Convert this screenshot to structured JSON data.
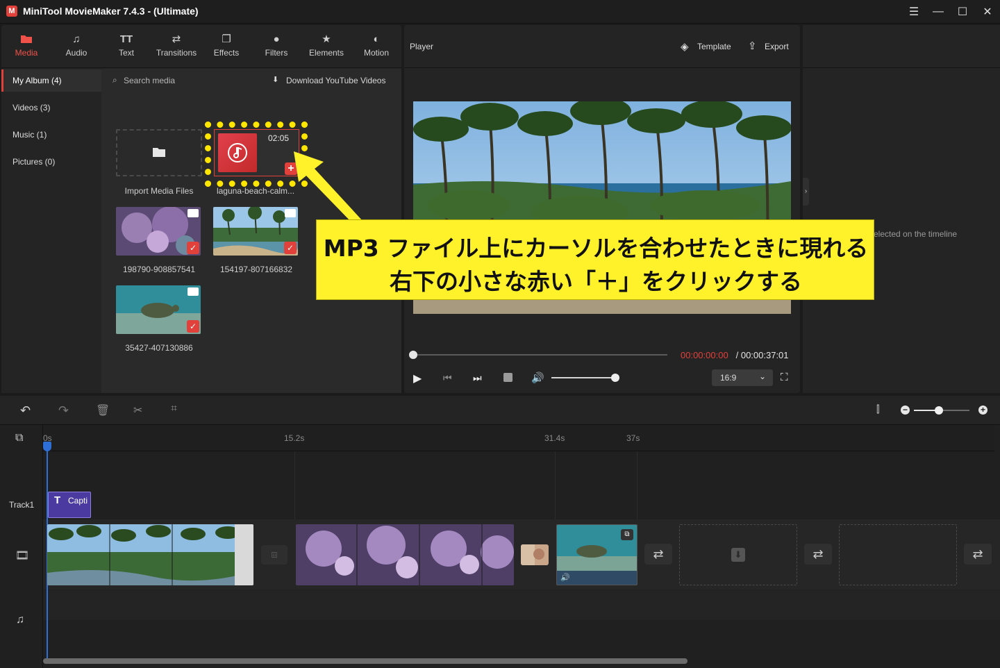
{
  "window": {
    "title": "MiniTool MovieMaker 7.4.3 - (Ultimate)"
  },
  "toolbar_tabs": [
    {
      "label": "Media",
      "icon": "folder-icon"
    },
    {
      "label": "Audio",
      "icon": "music-note-icon"
    },
    {
      "label": "Text",
      "icon": "text-icon"
    },
    {
      "label": "Transitions",
      "icon": "transition-icon"
    },
    {
      "label": "Effects",
      "icon": "effects-icon"
    },
    {
      "label": "Filters",
      "icon": "filters-icon"
    },
    {
      "label": "Elements",
      "icon": "elements-icon"
    },
    {
      "label": "Motion",
      "icon": "motion-icon"
    }
  ],
  "album": {
    "categories": [
      {
        "label": "My Album (4)"
      },
      {
        "label": "Videos (3)"
      },
      {
        "label": "Music (1)"
      },
      {
        "label": "Pictures (0)"
      }
    ],
    "search_placeholder": "Search media",
    "download_label": "Download YouTube Videos",
    "import_label": "Import Media Files",
    "music_item": {
      "duration": "02:05",
      "name": "laguna-beach-calm..."
    },
    "videos": [
      {
        "name": "198790-908857541"
      },
      {
        "name": "154197-807166832"
      },
      {
        "name": "35427-407130886"
      }
    ]
  },
  "player": {
    "title": "Player",
    "template_label": "Template",
    "export_label": "Export",
    "time_current": "00:00:00:00",
    "time_total": " / 00:00:37:01",
    "aspect": "16:9",
    "progress": 0,
    "volume": 1
  },
  "properties": {
    "hint": "elected on the timeline"
  },
  "timeline": {
    "ticks": [
      "0s",
      "15.2s",
      "31.4s",
      "37s"
    ],
    "track_label": "Track1",
    "caption_clip": "Capti",
    "zoom": 0.45
  },
  "callout": {
    "line1": "MP3 ファイル上にカーソルを合わせたときに現れる",
    "line2": "右下の小さな赤い「＋」をクリックする"
  },
  "colors": {
    "accent": "#e2403b",
    "callout_bg": "#fff22a",
    "highlight": "#ffe600"
  }
}
